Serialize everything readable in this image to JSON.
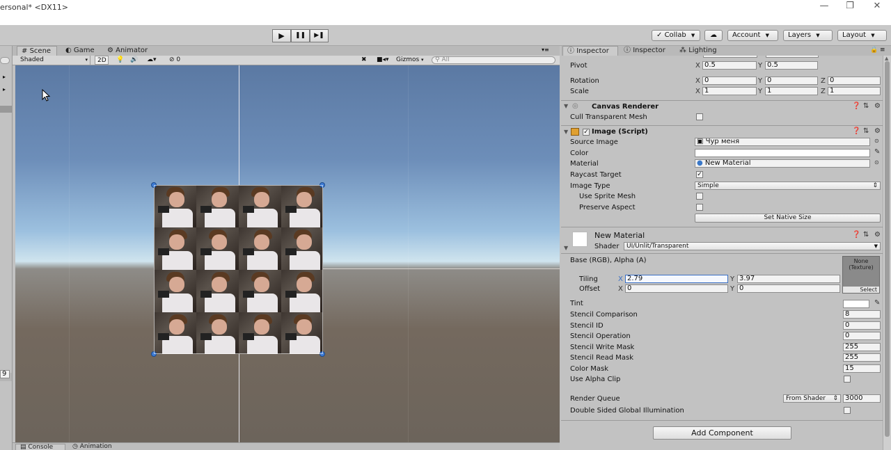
{
  "window": {
    "title": "ersonal* <DX11>",
    "minimize": "—",
    "maximize": "❐",
    "close": "✕"
  },
  "toolbar": {
    "play": "▶",
    "pause": "❚❚",
    "step": "▶❚",
    "collab": "Collab",
    "cloud": "☁",
    "account": "Account",
    "layers": "Layers",
    "layout": "Layout"
  },
  "scene_tabs": [
    {
      "label": "Scene",
      "icon": "#"
    },
    {
      "label": "Game",
      "icon": "◐"
    },
    {
      "label": "Animator",
      "icon": "⚙"
    }
  ],
  "scene_toolbar": {
    "shading": "Shaded",
    "mode_2d": "2D",
    "hidden_count": "0",
    "gizmos": "Gizmos",
    "search_placeholder": "All"
  },
  "left_strip": {
    "fragment": "9"
  },
  "bottom_tabs": {
    "console": "Console",
    "animation": "Animation"
  },
  "inspector_tabs": [
    {
      "label": "Inspector"
    },
    {
      "label": "Inspector"
    },
    {
      "label": "Lighting"
    }
  ],
  "transform": {
    "pivot": {
      "label": "Pivot",
      "x": "0.5",
      "y": "0.5"
    },
    "rotation": {
      "label": "Rotation",
      "x": "0",
      "y": "0",
      "z": "0"
    },
    "scale": {
      "label": "Scale",
      "x": "1",
      "y": "1",
      "z": "1"
    },
    "axis_x": "X",
    "axis_y": "Y",
    "axis_z": "Z"
  },
  "canvas_renderer": {
    "title": "Canvas Renderer",
    "cull_label": "Cull Transparent Mesh",
    "cull_checked": false
  },
  "image_script": {
    "title": "Image (Script)",
    "enabled": true,
    "source_image_label": "Source Image",
    "source_image_value": "Чур меня",
    "color_label": "Color",
    "color_value": "#ffffff",
    "material_label": "Material",
    "material_value": "New Material",
    "raycast_label": "Raycast Target",
    "raycast_checked": true,
    "image_type_label": "Image Type",
    "image_type_value": "Simple",
    "use_sprite_mesh_label": "Use Sprite Mesh",
    "preserve_aspect_label": "Preserve Aspect",
    "set_native_size": "Set Native Size"
  },
  "material": {
    "name": "New Material",
    "shader_label": "Shader",
    "shader_value": "UI/Unlit/Transparent",
    "base_label": "Base (RGB), Alpha (A)",
    "tiling_label": "Tiling",
    "tiling_x": "2.79",
    "tiling_y": "3.97",
    "offset_label": "Offset",
    "offset_x": "0",
    "offset_y": "0",
    "texture_none": "None",
    "texture_type": "(Texture)",
    "texture_select": "Select",
    "tint_label": "Tint",
    "properties": [
      {
        "label": "Stencil Comparison",
        "value": "8"
      },
      {
        "label": "Stencil ID",
        "value": "0"
      },
      {
        "label": "Stencil Operation",
        "value": "0"
      },
      {
        "label": "Stencil Write Mask",
        "value": "255"
      },
      {
        "label": "Stencil Read Mask",
        "value": "255"
      },
      {
        "label": "Color Mask",
        "value": "15"
      }
    ],
    "alpha_clip_label": "Use Alpha Clip",
    "render_queue_label": "Render Queue",
    "render_queue_mode": "From Shader",
    "render_queue_value": "3000",
    "double_sided_label": "Double Sided Global Illumination"
  },
  "add_component": "Add Component",
  "colors": {
    "accent": "#3d7cd6",
    "panel": "#c2c2c2"
  }
}
